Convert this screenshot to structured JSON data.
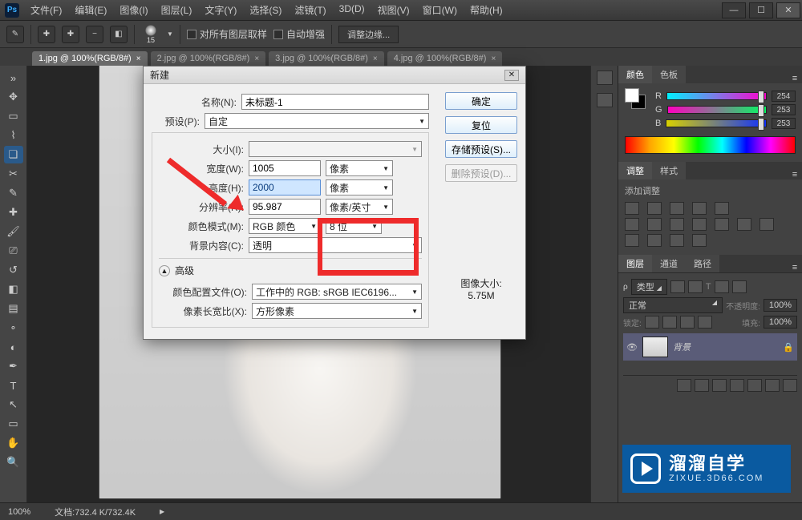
{
  "app": {
    "logo": "Ps"
  },
  "menus": [
    "文件(F)",
    "编辑(E)",
    "图像(I)",
    "图层(L)",
    "文字(Y)",
    "选择(S)",
    "滤镜(T)",
    "3D(D)",
    "视图(V)",
    "窗口(W)",
    "帮助(H)"
  ],
  "options": {
    "brush_size": "15",
    "check1": "对所有图层取样",
    "check2": "自动增强",
    "refine": "调整边缘..."
  },
  "tabs": [
    {
      "label": "1.jpg @ 100%(RGB/8#)",
      "active": true
    },
    {
      "label": "2.jpg @ 100%(RGB/8#)",
      "active": false
    },
    {
      "label": "3.jpg @ 100%(RGB/8#)",
      "active": false
    },
    {
      "label": "4.jpg @ 100%(RGB/8#)",
      "active": false
    }
  ],
  "dialog": {
    "title": "新建",
    "name_label": "名称(N):",
    "name_value": "未标题-1",
    "preset_label": "预设(P):",
    "preset_value": "自定",
    "size_label": "大小(I):",
    "width_label": "宽度(W):",
    "width_value": "1005",
    "width_unit": "像素",
    "height_label": "高度(H):",
    "height_value": "2000",
    "height_unit": "像素",
    "res_label": "分辨率(R):",
    "res_value": "95.987",
    "res_unit": "像素/英寸",
    "mode_label": "颜色模式(M):",
    "mode_value": "RGB 颜色",
    "depth_value": "8 位",
    "bg_label": "背景内容(C):",
    "bg_value": "透明",
    "advanced": "高级",
    "profile_label": "颜色配置文件(O):",
    "profile_value": "工作中的 RGB: sRGB IEC6196...",
    "aspect_label": "像素长宽比(X):",
    "aspect_value": "方形像素",
    "ok": "确定",
    "cancel": "复位",
    "save_preset": "存储预设(S)...",
    "delete_preset": "删除预设(D)...",
    "size_title": "图像大小:",
    "size_value": "5.75M"
  },
  "color_panel": {
    "tab1": "颜色",
    "tab2": "色板",
    "r_label": "R",
    "r_val": "254",
    "g_label": "G",
    "g_val": "253",
    "b_label": "B",
    "b_val": "253"
  },
  "adjust_panel": {
    "tab1": "调整",
    "tab2": "样式",
    "title": "添加调整"
  },
  "layers_panel": {
    "tab1": "图层",
    "tab2": "通道",
    "tab3": "路径",
    "filter": "类型",
    "blend": "正常",
    "opacity_label": "不透明度:",
    "opacity_val": "100%",
    "lock_label": "锁定:",
    "fill_label": "填充:",
    "fill_val": "100%",
    "layer_name": "背景"
  },
  "status": {
    "zoom": "100%",
    "doc": "文档:732.4 K/732.4K"
  },
  "watermark": {
    "cn": "溜溜自学",
    "url": "ZIXUE.3D66.COM"
  }
}
